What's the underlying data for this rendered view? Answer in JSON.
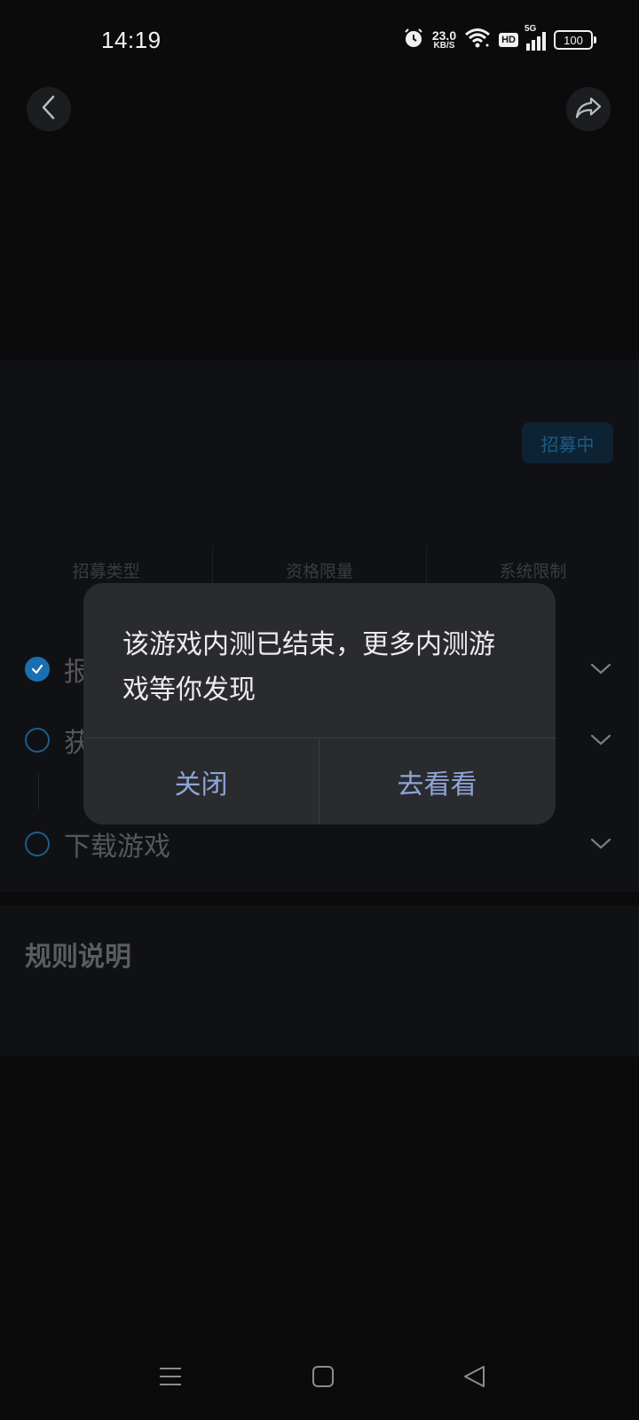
{
  "status_bar": {
    "time": "14:19",
    "net_speed_value": "23.0",
    "net_speed_unit": "KB/S",
    "hd_label": "HD",
    "network_label": "5G",
    "battery": "100"
  },
  "header": {
    "back_icon": "chevron-left-icon",
    "share_icon": "share-icon"
  },
  "recruit": {
    "status_badge": "招募中",
    "info_columns": [
      "招募类型",
      "资格限量",
      "系统限制"
    ]
  },
  "tasks": [
    {
      "label": "报",
      "done": true
    },
    {
      "label": "获",
      "done": false
    },
    {
      "label": "下载游戏",
      "done": false
    }
  ],
  "rules": {
    "title": "规则说明"
  },
  "dialog": {
    "message": "该游戏内测已结束，更多内测游戏等你发现",
    "close_label": "关闭",
    "go_label": "去看看"
  },
  "nav_bar": {
    "items": [
      "menu-icon",
      "home-icon",
      "back-triangle-icon"
    ]
  },
  "colors": {
    "background": "#0b0b0c",
    "card": "#101114",
    "dialog": "#2a2b2f",
    "dialog_button_text": "#8fa4d6",
    "accent": "#1a6fb0"
  }
}
